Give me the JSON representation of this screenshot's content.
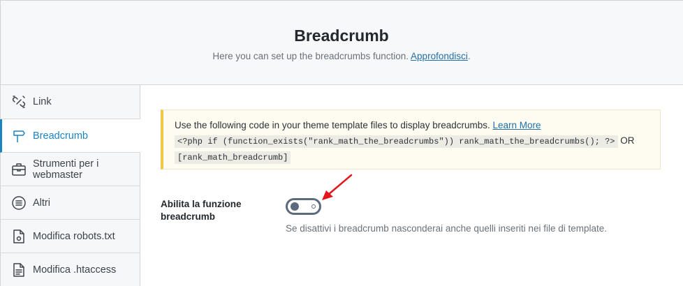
{
  "header": {
    "title": "Breadcrumb",
    "subtitle": "Here you can set up the breadcrumbs function.",
    "subtitle_link": "Approfondisci",
    "subtitle_end": "."
  },
  "sidebar": {
    "items": [
      {
        "label": "Link",
        "icon": "link-icon"
      },
      {
        "label": "Breadcrumb",
        "icon": "signpost-icon",
        "active": true
      },
      {
        "label": "Strumenti per i webmaster",
        "icon": "toolbox-icon"
      },
      {
        "label": "Altri",
        "icon": "list-circle-icon"
      },
      {
        "label": "Modifica robots.txt",
        "icon": "file-robot-icon"
      },
      {
        "label": "Modifica .htaccess",
        "icon": "file-lines-icon"
      }
    ]
  },
  "notice": {
    "text": "Use the following code in your theme template files to display breadcrumbs.",
    "link": "Learn More",
    "code1": "<?php if (function_exists(\"rank_math_the_breadcrumbs\")) rank_math_the_breadcrumbs(); ?>",
    "or": "OR",
    "code2": "[rank_math_breadcrumb]"
  },
  "setting": {
    "label": "Abilita la funzione breadcrumb",
    "toggle_state": "off",
    "description": "Se disattivi i breadcrumb nasconderai anche quelli inseriti nei file di template."
  },
  "colors": {
    "accent": "#1a83c2",
    "notice_border": "#f2c649",
    "annotation_arrow": "#e3161b"
  }
}
